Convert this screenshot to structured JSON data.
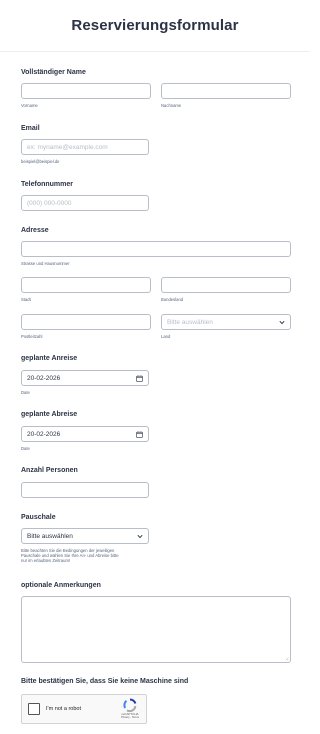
{
  "form_title": "Reservierungsformular",
  "name": {
    "label": "Vollständiger Name",
    "first_sub": "Vorname",
    "last_sub": "Nachname"
  },
  "email": {
    "label": "Email",
    "placeholder": "ex: myname@example.com",
    "sub": "beispiel@beispiel.de"
  },
  "phone": {
    "label": "Telefonnummer",
    "placeholder": "(000) 000-0000"
  },
  "address": {
    "label": "Adresse",
    "street_sub": "Strasse und Hausnummer",
    "city_sub": "Stadt",
    "state_sub": "Bundesland",
    "zip_sub": "Postleitzahl",
    "country_placeholder": "Bitte auswählen",
    "country_sub": "Land"
  },
  "arrival": {
    "label": "geplante Anreise",
    "value": "20-02-2026",
    "sub": "Date"
  },
  "departure": {
    "label": "geplante Abreise",
    "value": "20-02-2026",
    "sub": "Date"
  },
  "persons": {
    "label": "Anzahl Personen"
  },
  "package": {
    "label": "Pauschale",
    "value": "Bitte auswählen",
    "note_line1": "Bitte beachten Sie die Bedingungen der jeweiligen",
    "note_line2": "Pauschale und wählen Sie Ihre An- und Abreise bitte",
    "note_line3": "nur im erlaubten Zeitraum!"
  },
  "notes": {
    "label": "optionale Anmerkungen"
  },
  "captcha": {
    "label": "Bitte bestätigen Sie, dass Sie keine Maschine sind",
    "checkbox_text": "I'm not a robot",
    "brand": "reCAPTCHA",
    "terms": "Privacy - Terms"
  },
  "colors": {
    "text": "#2c3345",
    "border": "#b8bdc9",
    "placeholder": "#b8bdc9",
    "recaptcha_blue": "#1c3aa9",
    "recaptcha_light": "#4285f4",
    "recaptcha_gray": "#ababab"
  }
}
